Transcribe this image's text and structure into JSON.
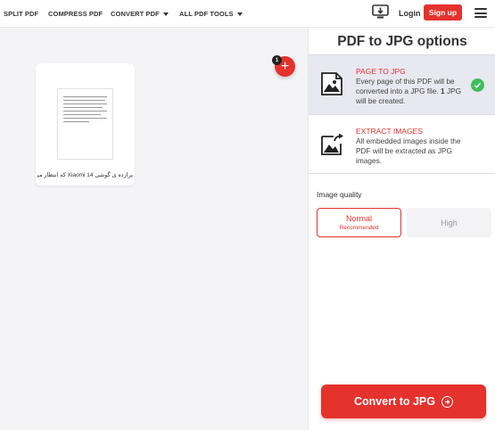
{
  "nav": {
    "split": "SPLIT PDF",
    "compress": "COMPRESS PDF",
    "convert": "CONVERT PDF",
    "tools": "ALL PDF TOOLS"
  },
  "header": {
    "login": "Login",
    "signup": "Sign up"
  },
  "workspace": {
    "file_name": "پرازده ی گوشی Xiaomi 14 که انتظار می",
    "file_count": "1"
  },
  "panel": {
    "title": "PDF to JPG options",
    "options": [
      {
        "title": "PAGE TO JPG",
        "desc_prefix": "Every page of this PDF will be converted into a JPG file.",
        "desc_count": "1",
        "desc_suffix": "JPG will be created.",
        "selected": true
      },
      {
        "title": "EXTRACT IMAGES",
        "desc": "All embedded images inside the PDF will be extracted as JPG images.",
        "selected": false
      }
    ],
    "quality_label": "Image quality",
    "quality_options": [
      {
        "label": "Normal",
        "sub": "Recommended",
        "selected": true
      },
      {
        "label": "High",
        "selected": false
      }
    ],
    "convert_label": "Convert to JPG"
  },
  "colors": {
    "accent": "#e5322d",
    "check": "#3fbd5b",
    "selected_bg": "#e8e8f0"
  },
  "icons": {
    "desktop": "desktop-download-icon",
    "menu": "hamburger-menu-icon",
    "page_to_jpg": "image-file-icon",
    "extract": "image-share-icon",
    "check": "check-circle-icon",
    "add": "plus-icon",
    "convert": "arrow-circle-right-icon"
  }
}
